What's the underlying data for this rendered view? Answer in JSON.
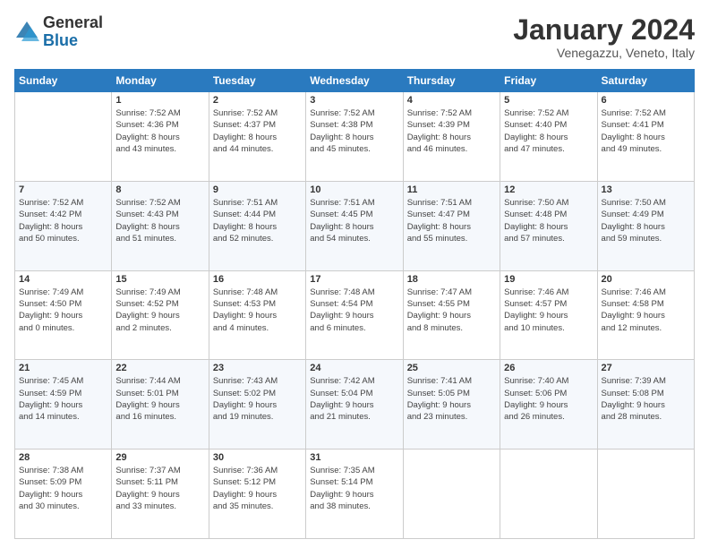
{
  "logo": {
    "general": "General",
    "blue": "Blue"
  },
  "header": {
    "month": "January 2024",
    "location": "Venegazzu, Veneto, Italy"
  },
  "weekdays": [
    "Sunday",
    "Monday",
    "Tuesday",
    "Wednesday",
    "Thursday",
    "Friday",
    "Saturday"
  ],
  "weeks": [
    [
      {
        "day": "",
        "info": ""
      },
      {
        "day": "1",
        "info": "Sunrise: 7:52 AM\nSunset: 4:36 PM\nDaylight: 8 hours\nand 43 minutes."
      },
      {
        "day": "2",
        "info": "Sunrise: 7:52 AM\nSunset: 4:37 PM\nDaylight: 8 hours\nand 44 minutes."
      },
      {
        "day": "3",
        "info": "Sunrise: 7:52 AM\nSunset: 4:38 PM\nDaylight: 8 hours\nand 45 minutes."
      },
      {
        "day": "4",
        "info": "Sunrise: 7:52 AM\nSunset: 4:39 PM\nDaylight: 8 hours\nand 46 minutes."
      },
      {
        "day": "5",
        "info": "Sunrise: 7:52 AM\nSunset: 4:40 PM\nDaylight: 8 hours\nand 47 minutes."
      },
      {
        "day": "6",
        "info": "Sunrise: 7:52 AM\nSunset: 4:41 PM\nDaylight: 8 hours\nand 49 minutes."
      }
    ],
    [
      {
        "day": "7",
        "info": "Sunrise: 7:52 AM\nSunset: 4:42 PM\nDaylight: 8 hours\nand 50 minutes."
      },
      {
        "day": "8",
        "info": "Sunrise: 7:52 AM\nSunset: 4:43 PM\nDaylight: 8 hours\nand 51 minutes."
      },
      {
        "day": "9",
        "info": "Sunrise: 7:51 AM\nSunset: 4:44 PM\nDaylight: 8 hours\nand 52 minutes."
      },
      {
        "day": "10",
        "info": "Sunrise: 7:51 AM\nSunset: 4:45 PM\nDaylight: 8 hours\nand 54 minutes."
      },
      {
        "day": "11",
        "info": "Sunrise: 7:51 AM\nSunset: 4:47 PM\nDaylight: 8 hours\nand 55 minutes."
      },
      {
        "day": "12",
        "info": "Sunrise: 7:50 AM\nSunset: 4:48 PM\nDaylight: 8 hours\nand 57 minutes."
      },
      {
        "day": "13",
        "info": "Sunrise: 7:50 AM\nSunset: 4:49 PM\nDaylight: 8 hours\nand 59 minutes."
      }
    ],
    [
      {
        "day": "14",
        "info": "Sunrise: 7:49 AM\nSunset: 4:50 PM\nDaylight: 9 hours\nand 0 minutes."
      },
      {
        "day": "15",
        "info": "Sunrise: 7:49 AM\nSunset: 4:52 PM\nDaylight: 9 hours\nand 2 minutes."
      },
      {
        "day": "16",
        "info": "Sunrise: 7:48 AM\nSunset: 4:53 PM\nDaylight: 9 hours\nand 4 minutes."
      },
      {
        "day": "17",
        "info": "Sunrise: 7:48 AM\nSunset: 4:54 PM\nDaylight: 9 hours\nand 6 minutes."
      },
      {
        "day": "18",
        "info": "Sunrise: 7:47 AM\nSunset: 4:55 PM\nDaylight: 9 hours\nand 8 minutes."
      },
      {
        "day": "19",
        "info": "Sunrise: 7:46 AM\nSunset: 4:57 PM\nDaylight: 9 hours\nand 10 minutes."
      },
      {
        "day": "20",
        "info": "Sunrise: 7:46 AM\nSunset: 4:58 PM\nDaylight: 9 hours\nand 12 minutes."
      }
    ],
    [
      {
        "day": "21",
        "info": "Sunrise: 7:45 AM\nSunset: 4:59 PM\nDaylight: 9 hours\nand 14 minutes."
      },
      {
        "day": "22",
        "info": "Sunrise: 7:44 AM\nSunset: 5:01 PM\nDaylight: 9 hours\nand 16 minutes."
      },
      {
        "day": "23",
        "info": "Sunrise: 7:43 AM\nSunset: 5:02 PM\nDaylight: 9 hours\nand 19 minutes."
      },
      {
        "day": "24",
        "info": "Sunrise: 7:42 AM\nSunset: 5:04 PM\nDaylight: 9 hours\nand 21 minutes."
      },
      {
        "day": "25",
        "info": "Sunrise: 7:41 AM\nSunset: 5:05 PM\nDaylight: 9 hours\nand 23 minutes."
      },
      {
        "day": "26",
        "info": "Sunrise: 7:40 AM\nSunset: 5:06 PM\nDaylight: 9 hours\nand 26 minutes."
      },
      {
        "day": "27",
        "info": "Sunrise: 7:39 AM\nSunset: 5:08 PM\nDaylight: 9 hours\nand 28 minutes."
      }
    ],
    [
      {
        "day": "28",
        "info": "Sunrise: 7:38 AM\nSunset: 5:09 PM\nDaylight: 9 hours\nand 30 minutes."
      },
      {
        "day": "29",
        "info": "Sunrise: 7:37 AM\nSunset: 5:11 PM\nDaylight: 9 hours\nand 33 minutes."
      },
      {
        "day": "30",
        "info": "Sunrise: 7:36 AM\nSunset: 5:12 PM\nDaylight: 9 hours\nand 35 minutes."
      },
      {
        "day": "31",
        "info": "Sunrise: 7:35 AM\nSunset: 5:14 PM\nDaylight: 9 hours\nand 38 minutes."
      },
      {
        "day": "",
        "info": ""
      },
      {
        "day": "",
        "info": ""
      },
      {
        "day": "",
        "info": ""
      }
    ]
  ]
}
